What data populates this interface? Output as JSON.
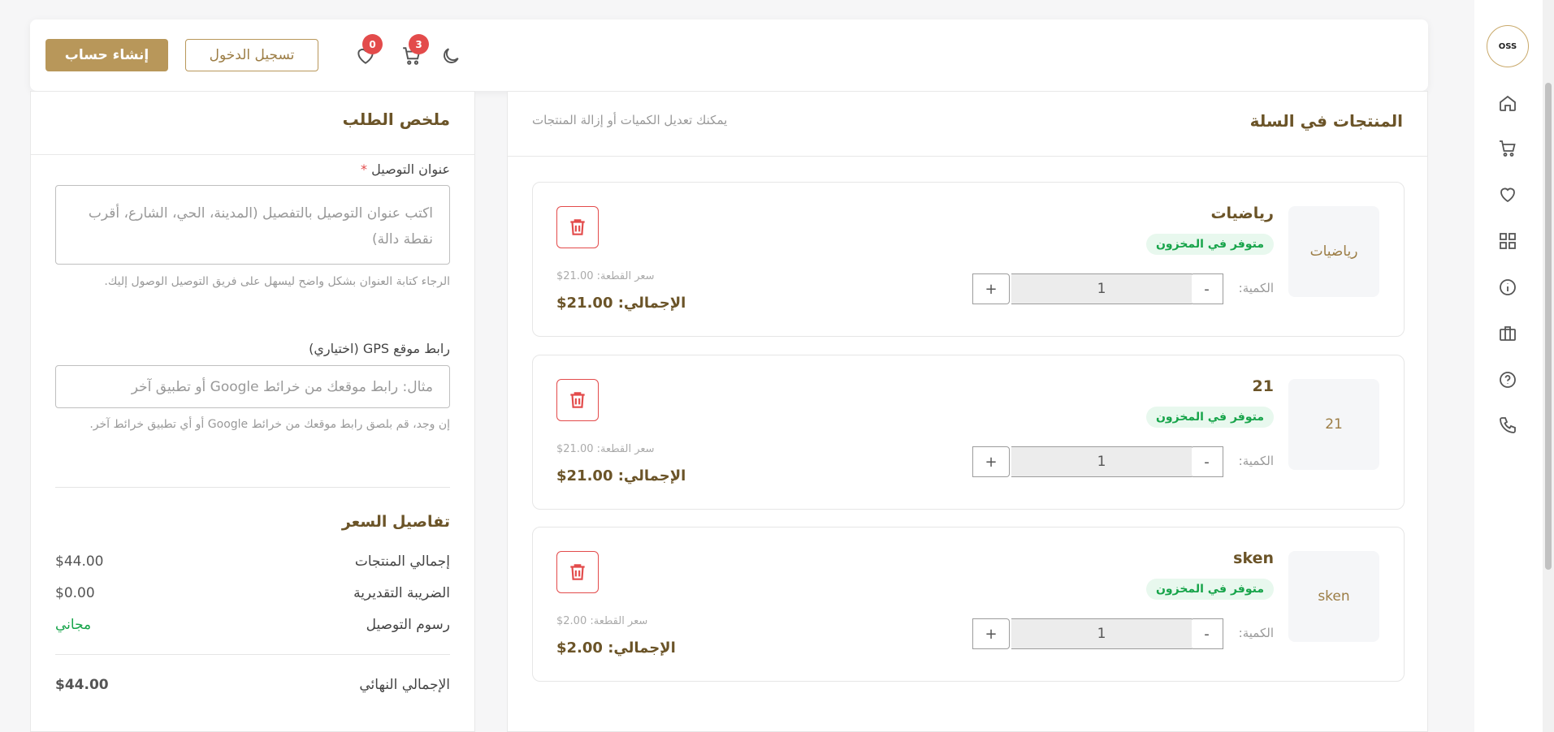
{
  "header": {
    "signup_label": "إنشاء حساب",
    "login_label": "تسجيل الدخول",
    "cart_count": "3",
    "wishlist_count": "0"
  },
  "sidebar": {
    "logo_text": "OSS",
    "items": [
      "home-icon",
      "cart-icon",
      "heart-icon",
      "grid-icon",
      "info-icon",
      "briefcase-icon",
      "help-icon",
      "phone-icon"
    ]
  },
  "cart": {
    "title": "المنتجات في السلة",
    "subtitle": "يمكنك تعديل الكميات أو إزالة المنتجات",
    "qty_label": "الكمية:",
    "minus": "-",
    "plus": "+",
    "items": [
      {
        "name": "رياضيات",
        "img_alt": "رياضيات",
        "stock": "متوفر في المخزون",
        "qty": "1",
        "unit_price": "سعر القطعة: 21.00$",
        "total": "الإجمالي: 21.00$"
      },
      {
        "name": "21",
        "img_alt": "21",
        "stock": "متوفر في المخزون",
        "qty": "1",
        "unit_price": "سعر القطعة: 21.00$",
        "total": "الإجمالي: 21.00$"
      },
      {
        "name": "sken",
        "img_alt": "sken",
        "stock": "متوفر في المخزون",
        "qty": "1",
        "unit_price": "سعر القطعة: 2.00$",
        "total": "الإجمالي: 2.00$"
      }
    ]
  },
  "summary": {
    "title": "ملخص الطلب",
    "address_label": "عنوان التوصيل",
    "required_mark": "*",
    "address_placeholder": "اكتب عنوان التوصيل بالتفصيل (المدينة، الحي، الشارع، أقرب نقطة دالة)",
    "address_help": "الرجاء كتابة العنوان بشكل واضح ليسهل على فريق التوصيل الوصول إليك.",
    "gps_label": "رابط موقع GPS (اختياري)",
    "gps_placeholder": "مثال: رابط موقعك من خرائط Google أو تطبيق آخر",
    "gps_help": "إن وجد، قم بلصق رابط موقعك من خرائط Google أو أي تطبيق خرائط آخر.",
    "price_title": "تفاصيل السعر",
    "products_total_label": "إجمالي المنتجات",
    "products_total_value": "$44.00",
    "tax_label": "الضريبة التقديرية",
    "tax_value": "$0.00",
    "shipping_label": "رسوم التوصيل",
    "shipping_value": "مجاني",
    "final_label": "الإجمالي النهائي",
    "final_value": "$44.00"
  }
}
